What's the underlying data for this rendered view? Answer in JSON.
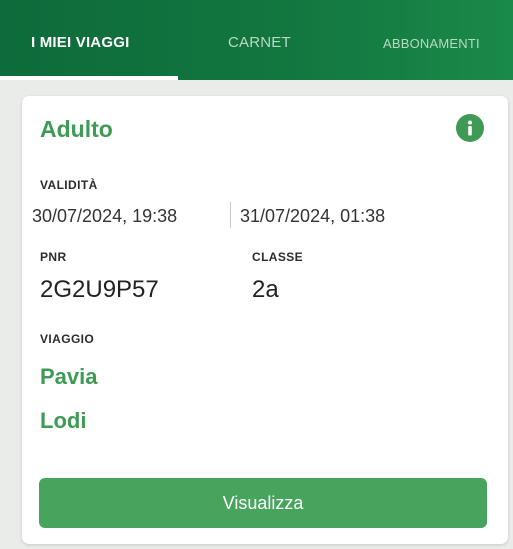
{
  "tabs": {
    "my_trips": "I MIEI VIAGGI",
    "carnet": "CARNET",
    "subscriptions": "ABBONAMENTI"
  },
  "ticket": {
    "passenger_type": "Adulto",
    "validity_label": "VALIDITÀ",
    "valid_from": "30/07/2024, 19:38",
    "valid_to": "31/07/2024, 01:38",
    "pnr_label": "PNR",
    "pnr": "2G2U9P57",
    "class_label": "CLASSE",
    "class_value": "2a",
    "trip_label": "VIAGGIO",
    "origin": "Pavia",
    "destination": "Lodi",
    "view_button": "Visualizza"
  },
  "colors": {
    "header_green": "#12763f",
    "accent_green": "#3f9a56",
    "button_green": "#47a45d"
  },
  "icons": {
    "info": "info-icon"
  }
}
